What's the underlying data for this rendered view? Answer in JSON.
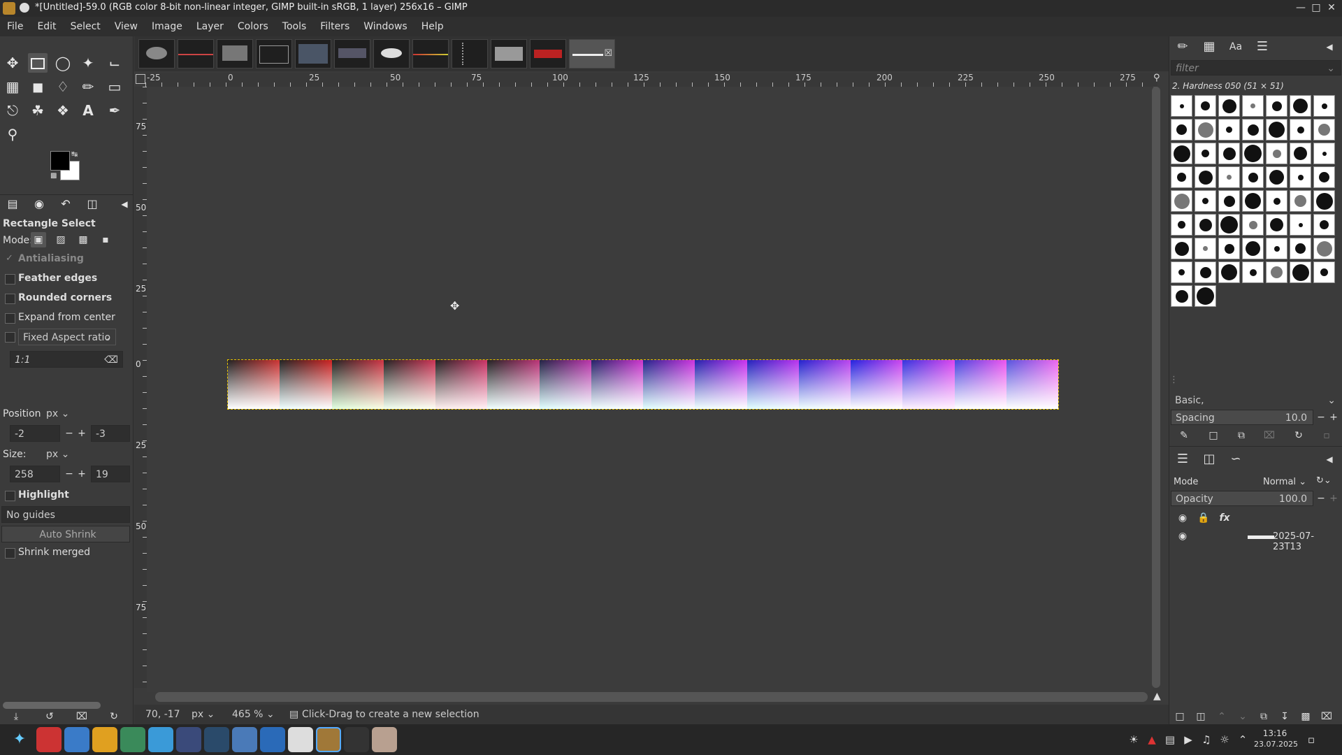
{
  "window": {
    "title": "*[Untitled]-59.0 (RGB color 8-bit non-linear integer, GIMP built-in sRGB, 1 layer) 256x16 – GIMP",
    "controls": [
      "minimize-icon",
      "maximize-icon",
      "close-icon"
    ]
  },
  "menu": [
    "File",
    "Edit",
    "Select",
    "View",
    "Image",
    "Layer",
    "Colors",
    "Tools",
    "Filters",
    "Windows",
    "Help"
  ],
  "toolbox": {
    "tools": [
      "move-icon",
      "rect-select-icon",
      "lasso-icon",
      "fuzzy-select-icon",
      "crop-icon",
      "transform-icon",
      "warp-icon",
      "bucket-icon",
      "paintbrush-icon",
      "eraser-icon",
      "clone-icon",
      "smudge-icon",
      "paths-icon",
      "text-icon",
      "color-picker-icon",
      "zoom-icon"
    ],
    "tool_options": {
      "title": "Rectangle Select",
      "mode_label": "Mode:",
      "antialiasing": "Antialiasing",
      "feather_edges": "Feather edges",
      "rounded_corners": "Rounded corners",
      "expand_from_center": "Expand from center",
      "fixed": "Fixed Aspect ratio",
      "ratio": "1:1",
      "position_label": "Position:",
      "position_unit": "px",
      "pos_x": "-2",
      "pos_y": "-3",
      "size_label": "Size:",
      "size_unit": "px",
      "size_w": "258",
      "size_h": "19",
      "highlight": "Highlight",
      "guides": "No guides",
      "auto_shrink": "Auto Shrink",
      "shrink_merged": "Shrink merged"
    }
  },
  "ruler": {
    "h_labels": [
      "-25",
      "0",
      "25",
      "50",
      "75",
      "100",
      "125",
      "150",
      "175",
      "200",
      "225",
      "250",
      "275"
    ],
    "v_labels": [
      "75",
      "50",
      "25",
      "0",
      "25",
      "50",
      "75"
    ]
  },
  "status": {
    "coords": "70, -17",
    "unit": "px",
    "zoom": "465 %",
    "message": "Click-Drag to create a new selection"
  },
  "brushes": {
    "filter_placeholder": "filter",
    "selected": "2. Hardness 050 (51 × 51)",
    "preset": "Basic,",
    "spacing_label": "Spacing",
    "spacing_value": "10.0"
  },
  "layers": {
    "mode_label": "Mode",
    "mode_value": "Normal",
    "opacity_label": "Opacity",
    "opacity_value": "100.0",
    "layer_name": "2025-07-23T13"
  },
  "taskbar": {
    "time": "13:16",
    "date": "23.07.2025"
  },
  "colors": {
    "selection": "#e6c200",
    "fg": "#000000",
    "bg": "#ffffff"
  }
}
